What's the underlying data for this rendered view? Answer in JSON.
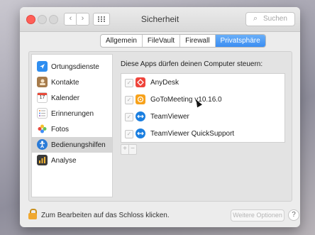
{
  "window": {
    "title": "Sicherheit"
  },
  "toolbar": {
    "back": "‹",
    "forward": "›",
    "search_placeholder": "Suchen"
  },
  "tabs": [
    {
      "label": "Allgemein",
      "active": false
    },
    {
      "label": "FileVault",
      "active": false
    },
    {
      "label": "Firewall",
      "active": false
    },
    {
      "label": "Privatsphäre",
      "active": true
    }
  ],
  "sidebar": {
    "items": [
      {
        "label": "Ortungsdienste",
        "icon": "location-arrow-icon",
        "color": "#2f8ef0"
      },
      {
        "label": "Kontakte",
        "icon": "contacts-book-icon",
        "color": "#a67b4b"
      },
      {
        "label": "Kalender",
        "icon": "calendar-icon",
        "color": "#ffffff",
        "day": "17"
      },
      {
        "label": "Erinnerungen",
        "icon": "reminders-list-icon",
        "color": "#ffffff"
      },
      {
        "label": "Fotos",
        "icon": "photos-flower-icon",
        "color": "#ffffff"
      },
      {
        "label": "Bedienungshilfen",
        "icon": "accessibility-icon",
        "color": "#2a7bd8",
        "selected": true
      },
      {
        "label": "Analyse",
        "icon": "analytics-chart-icon",
        "color": "#3a3a3a"
      }
    ]
  },
  "main": {
    "heading": "Diese Apps dürfen deinen Computer steuern:",
    "apps": [
      {
        "name": "AnyDesk",
        "checked": true,
        "color": "#ef443b"
      },
      {
        "name": "GoToMeeting v10.16.0",
        "checked": true,
        "color": "#f7a21b"
      },
      {
        "name": "TeamViewer",
        "checked": true,
        "color": "#1b7fe0"
      },
      {
        "name": "TeamViewer QuickSupport",
        "checked": true,
        "color": "#1b7fe0"
      }
    ],
    "add": "+",
    "remove": "−"
  },
  "footer": {
    "lock_text": "Zum Bearbeiten auf das Schloss klicken.",
    "advanced_button": "Weitere Optionen ...",
    "help": "?"
  }
}
